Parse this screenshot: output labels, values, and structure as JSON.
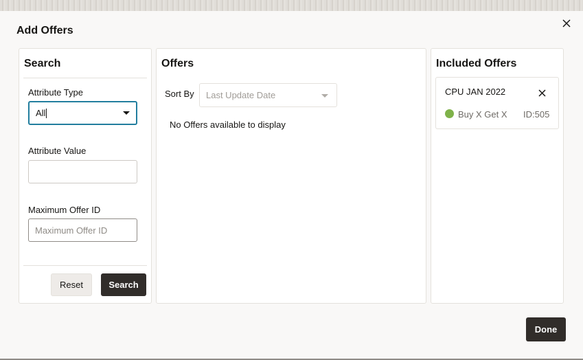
{
  "dialog": {
    "title": "Add Offers",
    "close_icon": "close-icon",
    "done_label": "Done"
  },
  "search_panel": {
    "title": "Search",
    "attribute_type": {
      "label": "Attribute Type",
      "value": "All"
    },
    "attribute_value": {
      "label": "Attribute Value",
      "value": "",
      "placeholder": ""
    },
    "max_offer_id": {
      "label": "Maximum Offer ID",
      "value": "",
      "placeholder": "Maximum Offer ID"
    },
    "reset_label": "Reset",
    "search_label": "Search"
  },
  "offers_panel": {
    "title": "Offers",
    "sort_by_label": "Sort By",
    "sort_placeholder": "Last Update Date",
    "empty_message": "No Offers available to display"
  },
  "included_panel": {
    "title": "Included Offers",
    "items": [
      {
        "name": "CPU JAN 2022",
        "type": "Buy X Get X",
        "id": "ID:505",
        "status_color": "#7fb24a"
      }
    ]
  },
  "colors": {
    "accent": "#227e9e",
    "primary_button": "#312d2a",
    "status_active": "#7fb24a"
  }
}
